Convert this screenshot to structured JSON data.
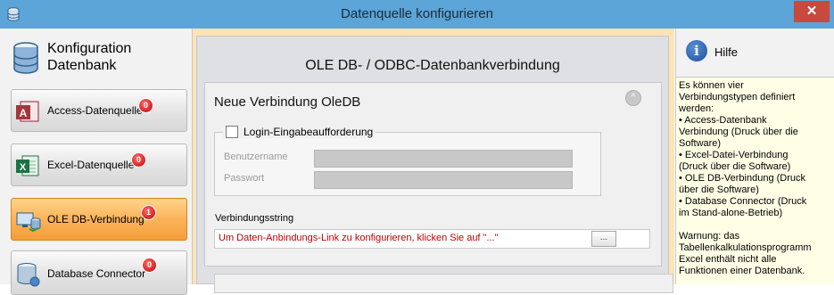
{
  "window": {
    "title": "Datenquelle konfigurieren",
    "close_label": "✕"
  },
  "sidebar": {
    "header": "Konfiguration\nDatenbank",
    "items": [
      {
        "label": "Access-Datenquelle",
        "badge": "0"
      },
      {
        "label": "Excel-Datenquelle",
        "badge": "0"
      },
      {
        "label": "OLE DB-Verbindung",
        "badge": "1"
      },
      {
        "label": "Database Connector",
        "badge": "0"
      }
    ]
  },
  "main": {
    "title": "OLE DB- / ODBC-Datenbankverbindung",
    "card_title": "Neue Verbindung OleDB",
    "collapse_label": "^",
    "login_label": "Login-Eingabeaufforderung",
    "username_label": "Benutzername",
    "password_label": "Passwort",
    "conn_label": "Verbindungsstring",
    "conn_value": "Um Daten-Anbindungs-Link zu konfigurieren, klicken Sie auf \"...\"",
    "browse_label": "..."
  },
  "help": {
    "title": "Hilfe",
    "text": "Es können vier\nVerbindungstypen definiert\nwerden:\n• Access-Datenbank\nVerbindung (Druck über die\nSoftware)\n• Excel-Datei-Verbindung\n(Druck über die Software)\n• OLE DB-Verbindung (Druck\nüber die Software)\n• Database Connector (Druck\nim Stand-alone-Betrieb)\n\nWarnung: das\nTabellenkalkulationsprogramm\nExcel enthält nicht alle\nFunktionen einer Datenbank."
  },
  "colors": {
    "titlebar": "#5ba5d8",
    "active": "#fbb35a",
    "badge": "#c40000",
    "close": "#c74a3c"
  }
}
